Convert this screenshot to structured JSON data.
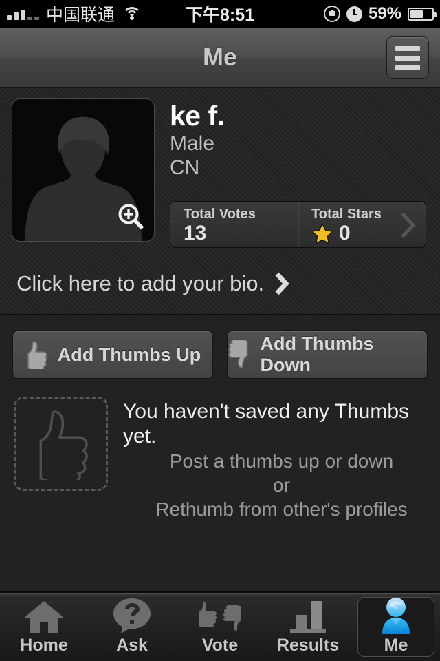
{
  "statusbar": {
    "carrier": "中国联通",
    "time": "下午8:51",
    "battery_percent": "59%",
    "signal_icon": "signal-bars-icon",
    "wifi_icon": "wifi-icon",
    "rotation_lock_icon": "rotation-lock-icon",
    "alarm_icon": "clock-icon",
    "battery_icon": "battery-icon"
  },
  "navbar": {
    "title": "Me",
    "menu_icon": "hamburger-menu-icon"
  },
  "profile": {
    "avatar_icon": "avatar-placeholder-icon",
    "zoom_icon": "magnifier-zoom-in-icon",
    "name": "ke f.",
    "gender": "Male",
    "country": "CN",
    "stats": [
      {
        "label": "Total Votes",
        "value": "13",
        "icon": null
      },
      {
        "label": "Total Stars",
        "value": "0",
        "icon": "star-icon"
      }
    ],
    "stats_chevron_icon": "chevron-right-icon",
    "bio_prompt": "Click here to add your bio.",
    "bio_chevron_icon": "chevron-right-icon"
  },
  "actions": [
    {
      "label": "Add Thumbs Up",
      "icon": "thumbs-up-icon"
    },
    {
      "label": "Add Thumbs Down",
      "icon": "thumbs-down-icon"
    }
  ],
  "empty_state": {
    "placeholder_icon": "thumbs-up-outline-icon",
    "title": "You haven't saved any Thumbs yet.",
    "line1": "Post a thumbs up or down",
    "line2": "or",
    "line3": "Rethumb from other's profiles"
  },
  "tabbar": {
    "items": [
      {
        "label": "Home",
        "icon": "home-icon",
        "active": false
      },
      {
        "label": "Ask",
        "icon": "question-bubble-icon",
        "active": false
      },
      {
        "label": "Vote",
        "icon": "thumbs-up-down-icon",
        "active": false
      },
      {
        "label": "Results",
        "icon": "bar-chart-icon",
        "active": false
      },
      {
        "label": "Me",
        "icon": "person-icon",
        "active": true
      }
    ]
  },
  "colors": {
    "background": "#222222",
    "accent_blue": "#2fb5f0",
    "star_gold": "#f2bf22",
    "text_primary": "#ffffff",
    "text_secondary": "#9a9a9a"
  }
}
